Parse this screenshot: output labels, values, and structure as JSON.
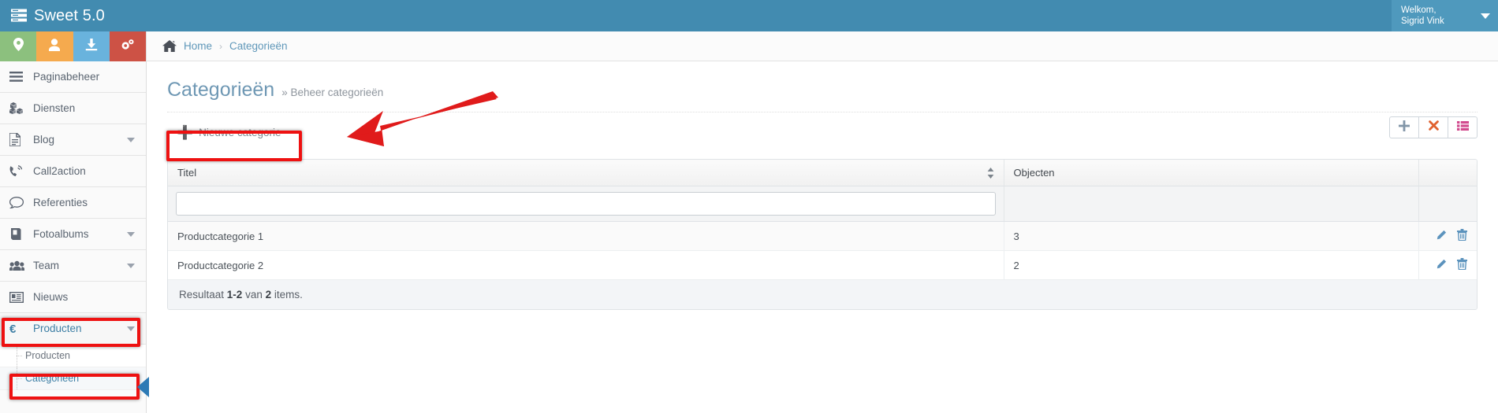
{
  "topbar": {
    "brand": "Sweet 5.0",
    "brand_icon": "server-icon",
    "user_greeting": "Welkom,",
    "user_name": "Sigrid Vink",
    "caret_icon": "caret-down-icon",
    "bg_color": "#428bb0",
    "user_bg_color": "#4f99bd"
  },
  "quick_buttons": [
    {
      "name": "map-marker-icon",
      "color": "#8cc07e"
    },
    {
      "name": "user-icon",
      "color": "#f5aa4e"
    },
    {
      "name": "download-icon",
      "color": "#69b3dd"
    },
    {
      "name": "cogs-icon",
      "color": "#cd5245"
    }
  ],
  "breadcrumb": {
    "home_icon": "home-icon",
    "home": "Home",
    "separator": "›",
    "current": "Categorieën"
  },
  "sidebar": {
    "items": [
      {
        "label": "Paginabeheer",
        "icon": "bars-icon",
        "caret": false
      },
      {
        "label": "Diensten",
        "icon": "cubes-icon",
        "caret": false
      },
      {
        "label": "Blog",
        "icon": "file-text-icon",
        "caret": true
      },
      {
        "label": "Call2action",
        "icon": "phone-volume-icon",
        "caret": false
      },
      {
        "label": "Referenties",
        "icon": "comment-icon",
        "caret": false
      },
      {
        "label": "Fotoalbums",
        "icon": "book-icon",
        "caret": true
      },
      {
        "label": "Team",
        "icon": "users-icon",
        "caret": true
      },
      {
        "label": "Nieuws",
        "icon": "newspaper-icon",
        "caret": false
      },
      {
        "label": "Producten",
        "icon": "euro-icon",
        "caret": true,
        "active": true
      }
    ],
    "submenu": [
      {
        "label": "Producten",
        "selected": false
      },
      {
        "label": "Categorieën",
        "selected": true
      }
    ]
  },
  "page": {
    "title": "Categorieën",
    "subtitle": "» Beheer categorieën"
  },
  "toolbar": {
    "new_label": "Nieuwe categorie",
    "new_icon": "plus-icon",
    "buttons": [
      {
        "name": "add-button",
        "icon": "plus-icon",
        "color": "#8296a8"
      },
      {
        "name": "delete-button",
        "icon": "times-icon",
        "color": "#e0612f"
      },
      {
        "name": "columns-button",
        "icon": "list-icon",
        "color": "#d24a8e"
      }
    ]
  },
  "table": {
    "columns": [
      {
        "key": "titel",
        "label": "Titel",
        "sortable": true,
        "sort_icon": "sort-icon"
      },
      {
        "key": "objecten",
        "label": "Objecten",
        "sortable": false
      },
      {
        "key": "acties",
        "label": "",
        "sortable": false
      }
    ],
    "filter": {
      "titel_value": "",
      "titel_placeholder": ""
    },
    "rows": [
      {
        "titel": "Productcategorie 1",
        "objecten": "3",
        "edit_icon": "pencil-icon",
        "delete_icon": "trash-icon"
      },
      {
        "titel": "Productcategorie 2",
        "objecten": "2",
        "edit_icon": "pencil-icon",
        "delete_icon": "trash-icon"
      }
    ],
    "footer": {
      "prefix": "Resultaat ",
      "range": "1-2",
      "middle": " van ",
      "total": "2",
      "suffix": " items."
    }
  },
  "annotations": {
    "arrow_color": "#e01b1b",
    "box_color": "#ee1111",
    "pointer_color": "#2d7ab5",
    "arrow_name": "red-arrow-annotation"
  }
}
